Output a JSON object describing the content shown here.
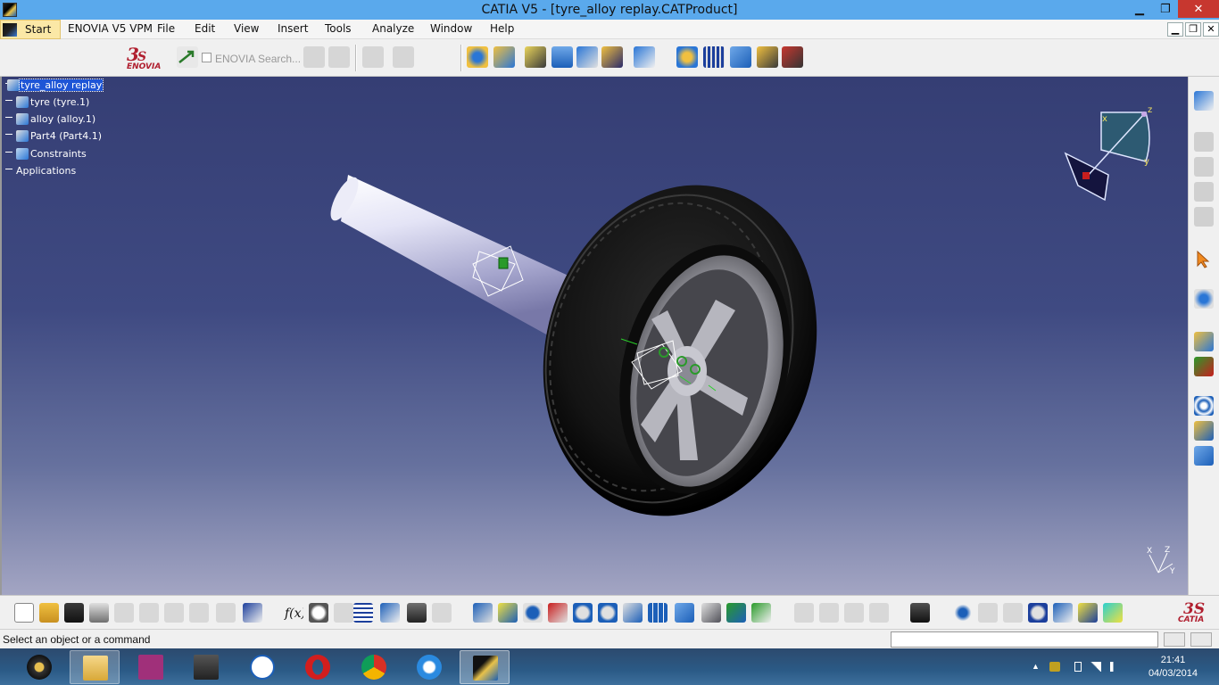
{
  "window": {
    "title": "CATIA V5 - [tyre_alloy replay.CATProduct]",
    "minimize": "▁",
    "restore": "❐",
    "close": "✕"
  },
  "menubar": {
    "items": [
      "Start",
      "ENOVIA V5 VPM",
      "File",
      "Edit",
      "View",
      "Insert",
      "Tools",
      "Analyze",
      "Window",
      "Help"
    ],
    "doc_controls": [
      "▁",
      "❐",
      "✕"
    ]
  },
  "toolbar": {
    "brand": "ENOVIA",
    "search_placeholder": "ENOVIA Search...",
    "ds_logo": "DS"
  },
  "tree": {
    "root": "tyre_alloy replay",
    "children": [
      "tyre (tyre.1)",
      "alloy (alloy.1)",
      "Part4 (Part4.1)",
      "Constraints",
      "Applications"
    ]
  },
  "compass": {
    "x": "x",
    "y": "y",
    "z": "z"
  },
  "axis_triad": {
    "x": "X",
    "z": "Z",
    "y": "Y"
  },
  "bottom_brand": {
    "logo": "DS",
    "text": "CATIA"
  },
  "statusbar": {
    "message": "Select an object or a command",
    "command_value": ""
  },
  "taskbar": {
    "time": "21:41",
    "date": "04/03/2014"
  },
  "colors": {
    "title_bar": "#5aa9ec",
    "viewport_top": "#353e74",
    "viewport_bottom": "#a3a5c3",
    "selection": "#1e55d6",
    "taskbar": "#2b5a86"
  }
}
